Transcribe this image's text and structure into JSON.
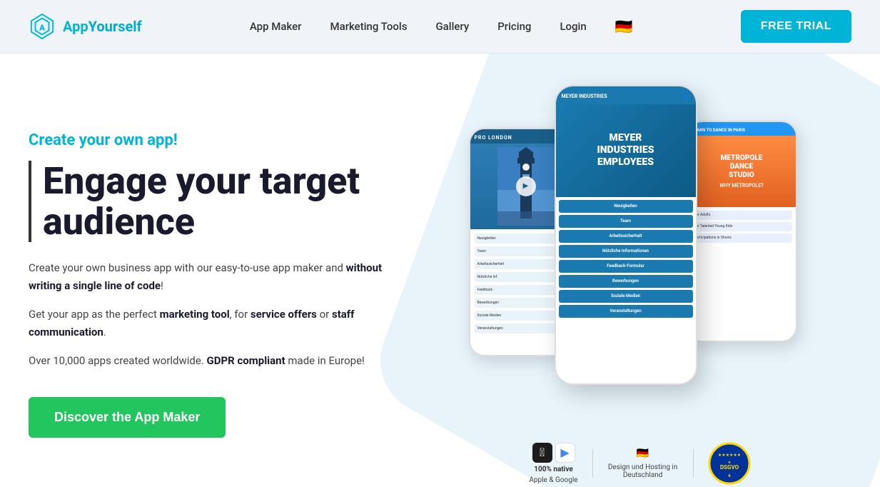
{
  "header": {
    "logo_text_app": "App",
    "logo_text_yourself": "Yourself",
    "nav": {
      "app_maker": "App Maker",
      "marketing_tools": "Marketing Tools",
      "gallery": "Gallery",
      "pricing": "Pricing",
      "login": "Login"
    },
    "free_trial": "FREE TRIAL",
    "language_flag": "🇩🇪"
  },
  "hero": {
    "tagline": "Create your own app!",
    "heading_line1": "Engage your target",
    "heading_line2": "audience",
    "desc1_plain": "Create your own business app with our easy-to-use app maker and ",
    "desc1_bold": "without writing a single line of code",
    "desc1_end": "!",
    "desc2_plain1": "Get your app as the perfect ",
    "desc2_bold1": "marketing tool",
    "desc2_plain2": ", for ",
    "desc2_bold2": "service offers",
    "desc2_plain3": " or ",
    "desc2_bold3": "staff communication",
    "desc2_end": ".",
    "desc3_plain": "Over 10,000 apps created worldwide. ",
    "desc3_bold": "GDPR compliant",
    "desc3_end": " made in Europe!",
    "cta": "Discover the App Maker"
  },
  "phones": {
    "left": {
      "label": "PRO LONDON",
      "city": "LONDON",
      "menu_items": [
        "Neuigkeiten",
        "Team",
        "Arbeitssicherheit",
        "Nützliche Informationen",
        "Feedback-Formular",
        "Bewerbungen",
        "Soziale Medien",
        "Veranstaltungen"
      ]
    },
    "center": {
      "header_label": "MEYER INDUSTRIES",
      "subtitle": "EMPLOYEES",
      "company_name": "MEYER INDUSTRIES EMPLOYEES",
      "menu_items": [
        "Neuigkeiten",
        "Team",
        "Arbeitssicherheit",
        "Nützliche Informationen",
        "Feedback-Formular",
        "Bewerbungen",
        "Soziale Medien",
        "Veranstaltungen"
      ]
    },
    "right": {
      "header_label": "LEARN TO DANCE IN PARIS",
      "title": "METROPOLE DANCE STUDIO",
      "subtitle": "WHY METROPOLE?",
      "menu_items": [
        "For Adults",
        "For Talented Young Kids",
        "Participations in Shows"
      ]
    }
  },
  "badges": {
    "native_label": "100% native",
    "platform_label": "Apple & Google",
    "design_label": "Design und Hosting in Deutschland",
    "dsgvo_label": "DSGVO"
  },
  "colors": {
    "teal": "#00b4d8",
    "green": "#22c55e",
    "phone_blue": "#1a7ab0"
  }
}
